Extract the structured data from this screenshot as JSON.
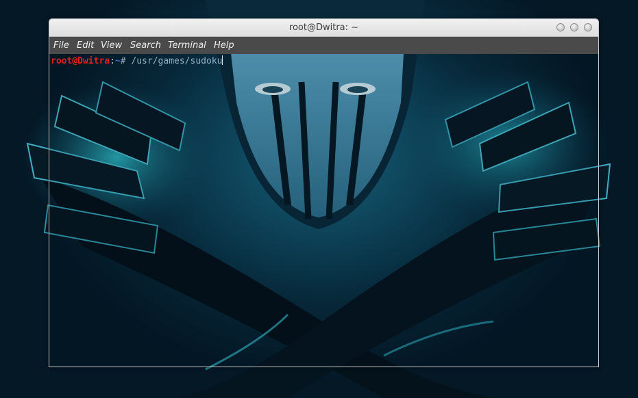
{
  "window": {
    "title": "root@Dwitra: ~"
  },
  "menu": {
    "file": "File",
    "edit": "Edit",
    "view": "View",
    "search": "Search",
    "terminal": "Terminal",
    "help": "Help"
  },
  "terminal": {
    "prompt_user": "root@Dwitra",
    "prompt_sep": ":",
    "prompt_path": "~",
    "prompt_symbol": "# ",
    "command": "/usr/games/sudoku"
  },
  "colors": {
    "prompt_user": "#e02020",
    "prompt_path": "#3a6ad6",
    "menubar_bg": "#4a4a4a",
    "titlebar_bg": "#e6e6e6"
  },
  "icons": [
    "minimize-icon",
    "maximize-icon",
    "close-icon"
  ]
}
